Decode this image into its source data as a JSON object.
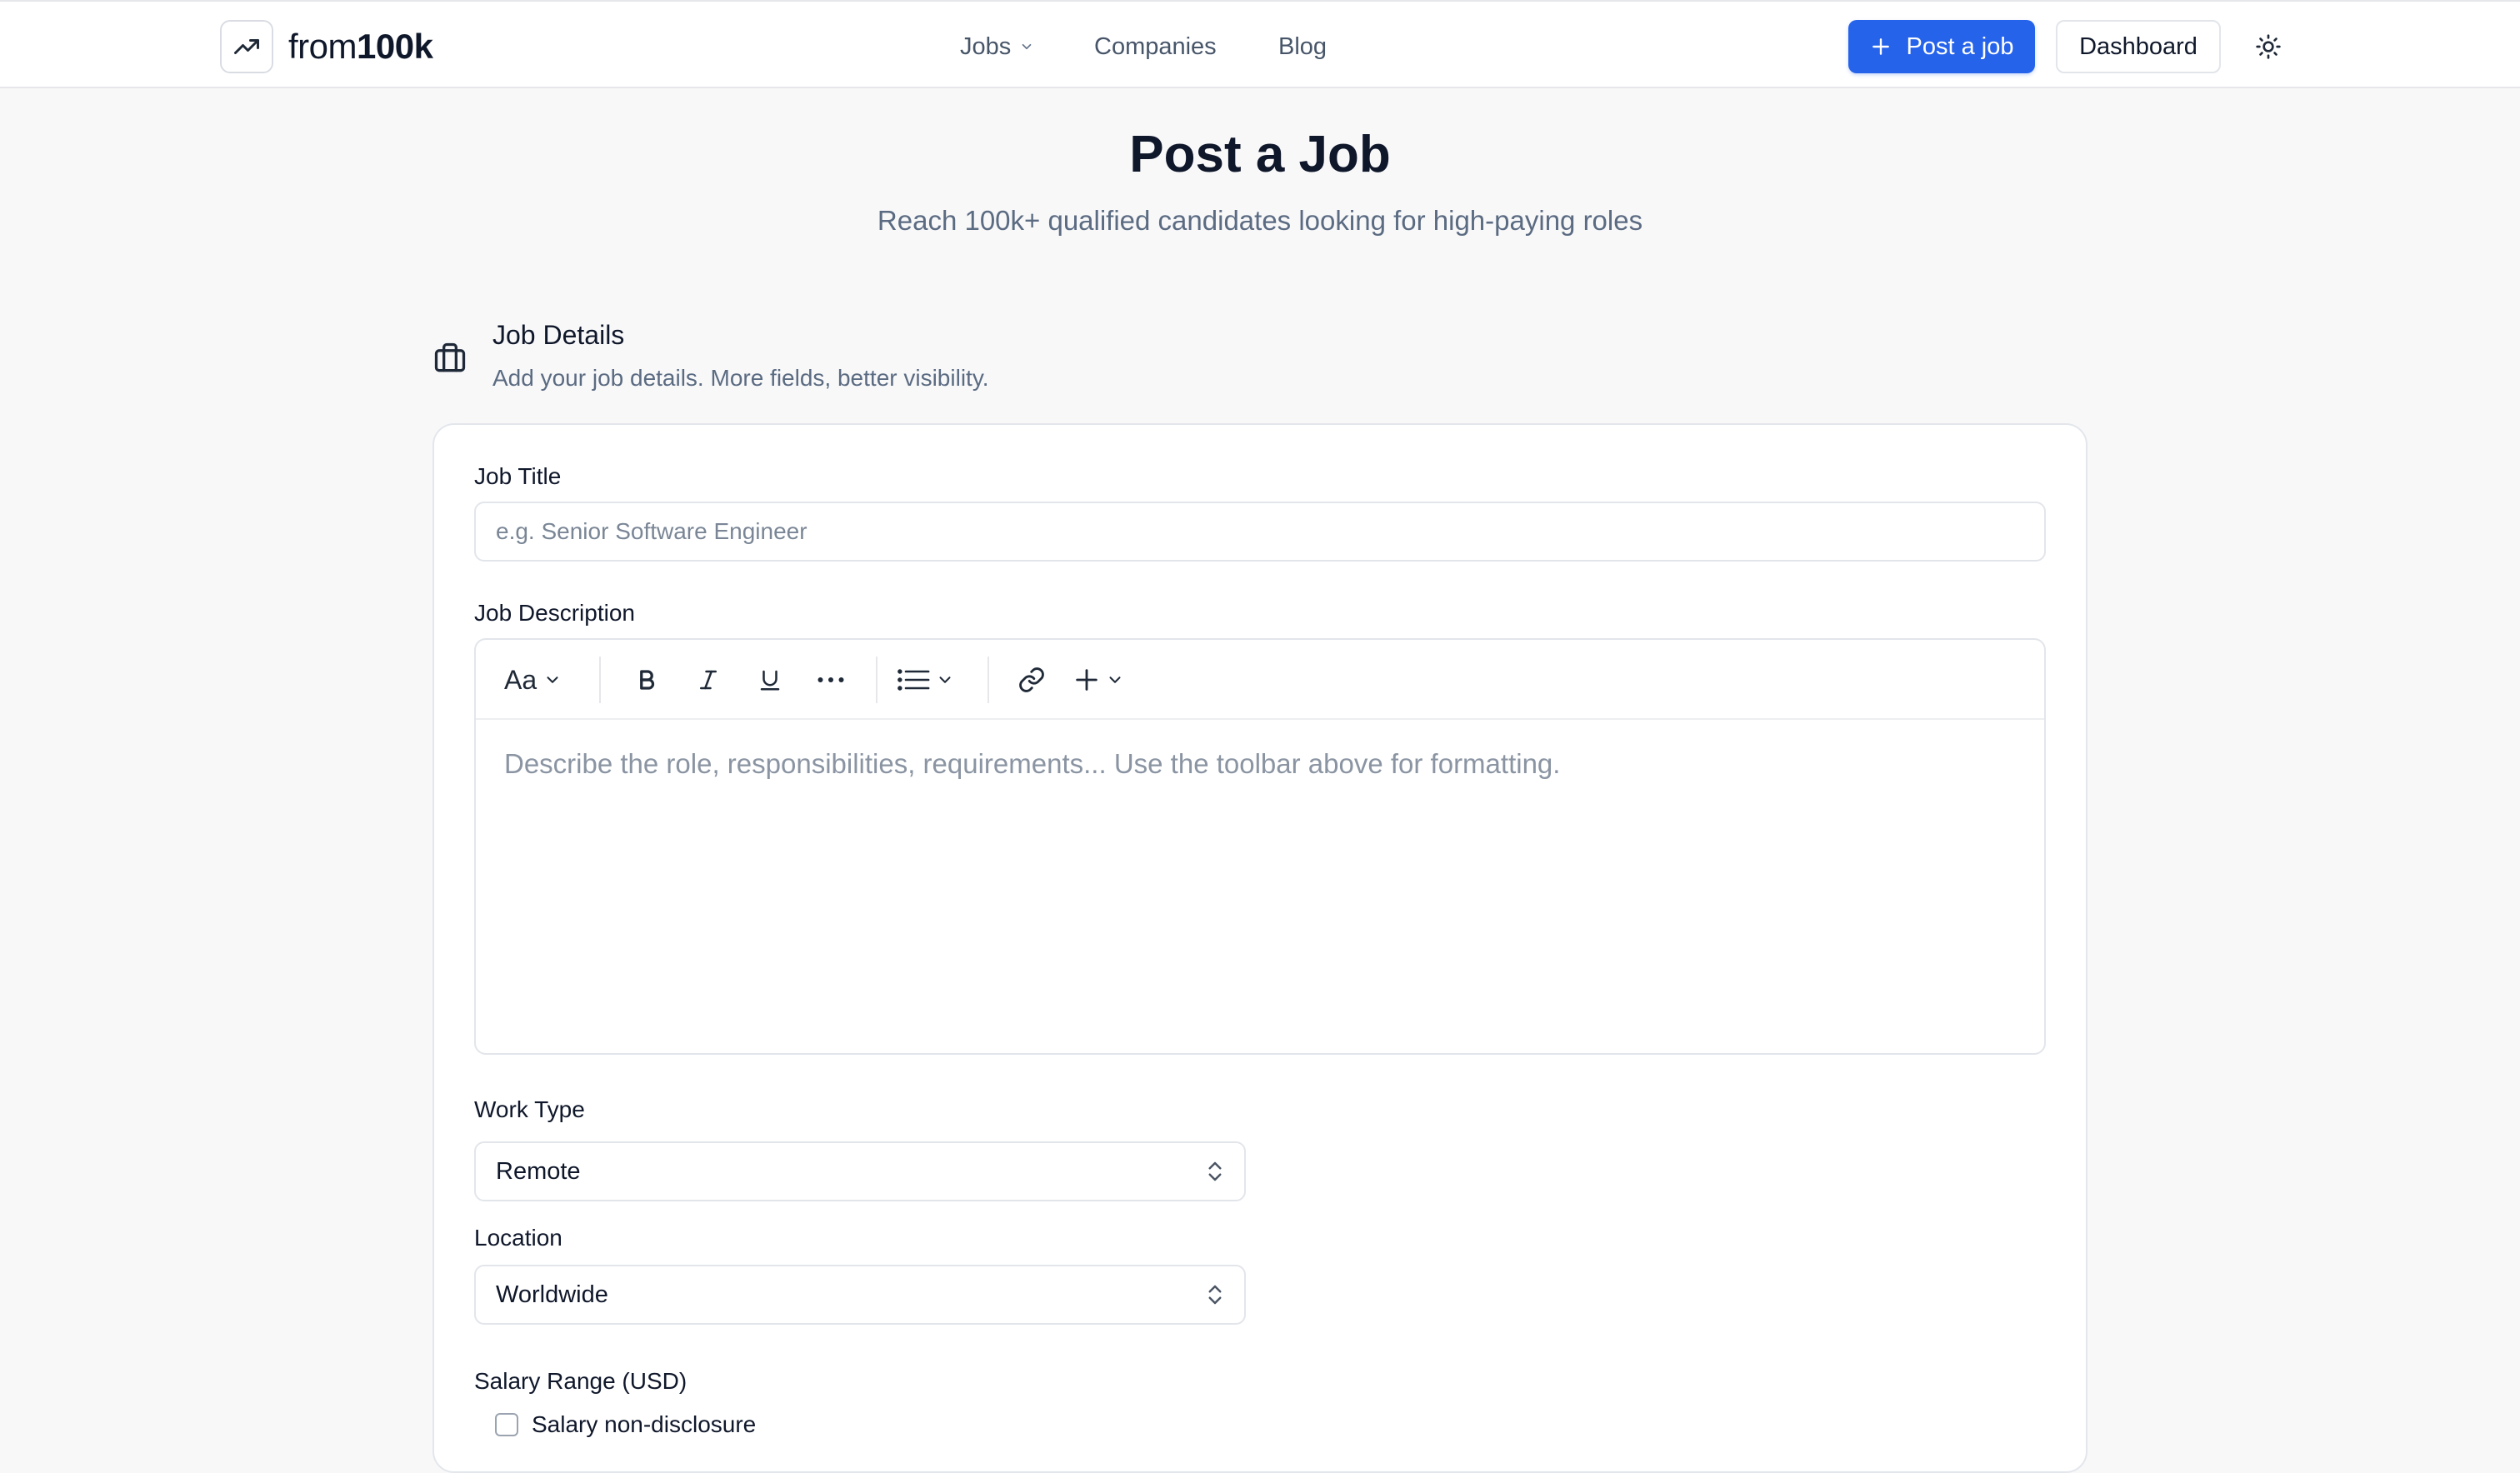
{
  "header": {
    "logo_prefix": "from",
    "logo_suffix": "100k",
    "nav": {
      "jobs": "Jobs",
      "companies": "Companies",
      "blog": "Blog"
    },
    "post_job_label": "Post a job",
    "dashboard_label": "Dashboard",
    "accent_color": "#2563eb"
  },
  "hero": {
    "title": "Post a Job",
    "subtitle": "Reach 100k+ qualified candidates looking for high-paying roles"
  },
  "section": {
    "title": "Job Details",
    "description": "Add your job details. More fields, better visibility.",
    "icon": "briefcase-icon"
  },
  "form": {
    "job_title_label": "Job Title",
    "job_title_placeholder": "e.g. Senior Software Engineer",
    "job_description_label": "Job Description",
    "editor_toolbar": {
      "font_size": "Aa"
    },
    "job_description_placeholder": "Describe the role, responsibilities, requirements... Use the toolbar above for formatting.",
    "work_type_label": "Work Type",
    "work_type_value": "Remote",
    "location_label": "Location",
    "location_value": "Worldwide",
    "salary_label": "Salary Range (USD)",
    "salary_non_disclosure_label": "Salary non-disclosure"
  }
}
